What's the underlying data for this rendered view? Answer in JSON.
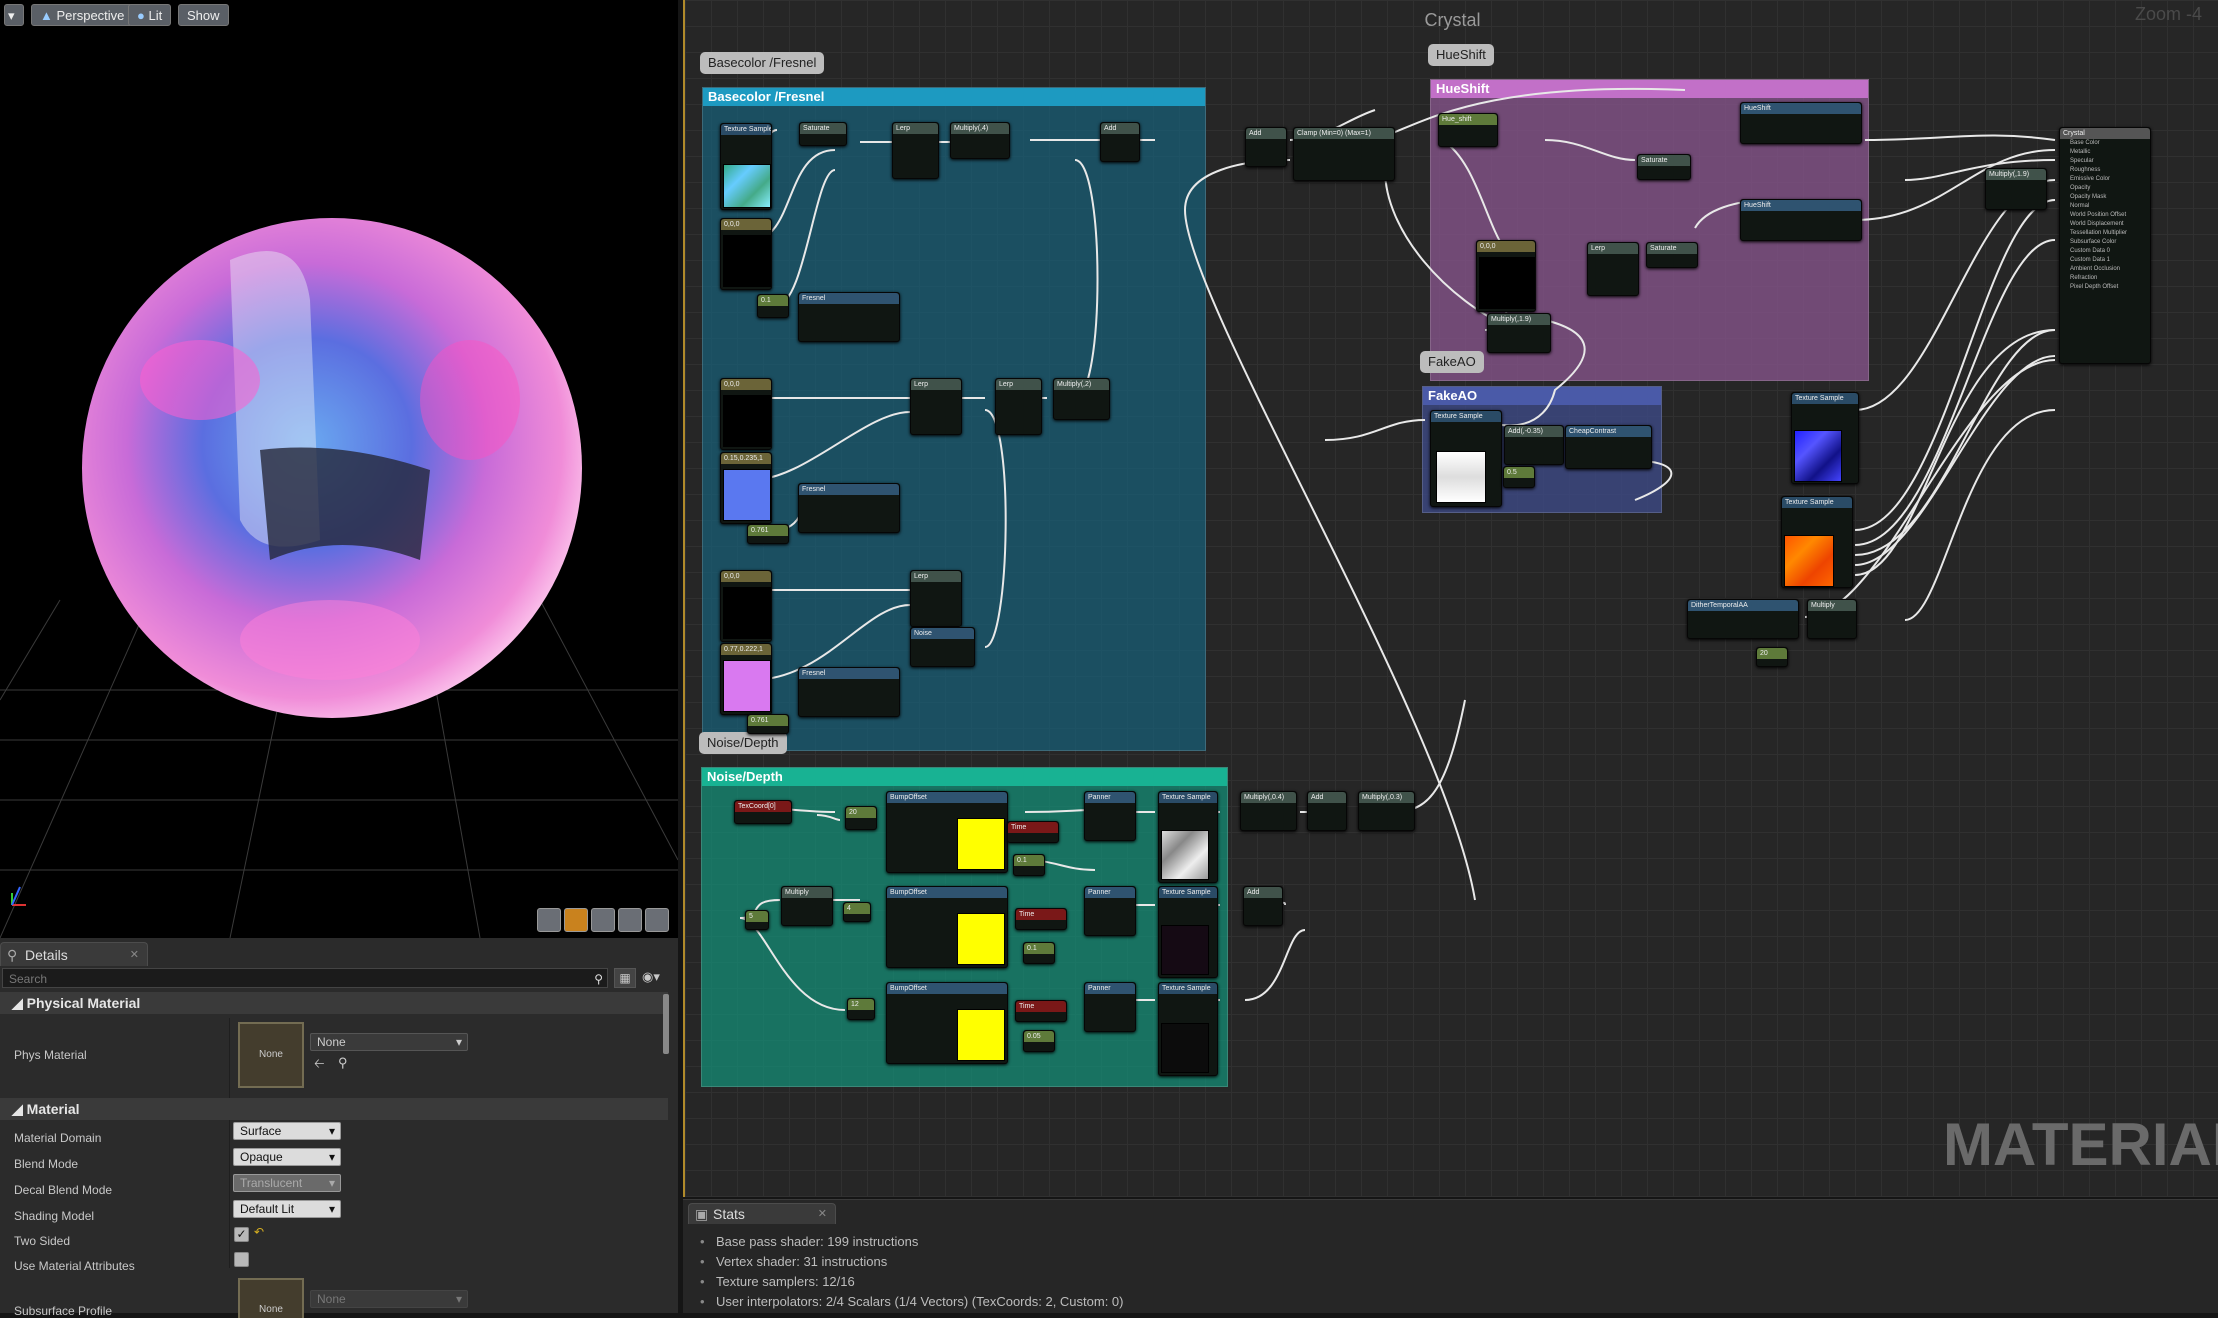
{
  "viewport": {
    "buttons": {
      "perspective": "Perspective",
      "lit": "Lit",
      "show": "Show"
    }
  },
  "details": {
    "tab_label": "Details",
    "search_placeholder": "Search",
    "physical_material": {
      "category": "Physical Material",
      "phys_material_label": "Phys Material",
      "thumb_text": "None",
      "value": "None"
    },
    "material": {
      "category": "Material",
      "properties": [
        {
          "label": "Material Domain",
          "value": "Surface",
          "disabled": false
        },
        {
          "label": "Blend Mode",
          "value": "Opaque",
          "disabled": false
        },
        {
          "label": "Decal Blend Mode",
          "value": "Translucent",
          "disabled": true
        },
        {
          "label": "Shading Model",
          "value": "Default Lit",
          "disabled": false
        }
      ],
      "two_sided_label": "Two Sided",
      "use_material_attributes_label": "Use Material Attributes",
      "subsurface_profile_label": "Subsurface Profile",
      "subsurface_thumb_text": "None",
      "subsurface_value": "None"
    }
  },
  "graph": {
    "title": "Crystal",
    "zoom": "Zoom -4",
    "watermark": "MATERIAL",
    "groups": {
      "basecolor": "Basecolor /Fresnel",
      "hueshift": "HueShift",
      "fakeao": "FakeAO",
      "noise": "Noise/Depth"
    },
    "bubbles": {
      "basecolor": "Basecolor /Fresnel",
      "hueshift": "HueShift",
      "fakeao": "FakeAO",
      "noise": "Noise/Depth"
    },
    "nodes": {
      "tex1": "Texture Sample",
      "saturate1": "Saturate",
      "lerp1": "Lerp",
      "multiply_4": "Multiply(,4)",
      "add1": "Add",
      "const_000": "0,0,0",
      "scalar_01": "0.1",
      "fresnel1": "Fresnel",
      "const_000b": "0,0,0",
      "lerp2": "Lerp",
      "lerp3": "Lerp",
      "multiply_2": "Multiply(,2)",
      "const_blue": "0.15,0.235,1",
      "fresnel2": "Fresnel",
      "scalar_2": "0.761",
      "const_000c": "0,0,0",
      "lerp4": "Lerp",
      "noise": "Noise",
      "const_pink": "0.77,0.222,1",
      "fresnel3": "Fresnel",
      "scalar_3": "0.761",
      "add2": "Add",
      "clamp": "Clamp (Min=0) (Max=1)",
      "hue_shift_param": "Hue_shift",
      "hue_fn1": "HueShift",
      "saturate2": "Saturate",
      "hue_fn2": "HueShift",
      "const_000d": "0,0,0",
      "lerp5": "Lerp",
      "saturate3": "Saturate",
      "multiply_1": "Multiply(,1.9)",
      "tex_ao": "Texture Sample",
      "add_ao": "Add(,-0.35)",
      "cheap_contrast": "CheapContrast",
      "scalar_ao": "0.5",
      "root": "Crystal",
      "multiply_root": "Multiply(,1.9)",
      "tex_blue": "Texture Sample",
      "tex_orange": "Texture Sample",
      "dither": "DitherTemporalAA",
      "multiply_dither": "Multiply",
      "scalar_dither": "20",
      "texcoord": "TexCoord[0]",
      "scalar_20": "20",
      "bump1": "BumpOffset",
      "time1": "Time",
      "scalar_t1": "0.1",
      "panner1": "Panner",
      "tex_n1": "Texture Sample",
      "multiply_n1": "Multiply(,0.4)",
      "add_n1": "Add",
      "multiply_n2": "Multiply(,0.3)",
      "multiply_n": "Multiply",
      "scalar_5": "5",
      "scalar_4": "4",
      "bump2": "BumpOffset",
      "time2": "Time",
      "scalar_t2": "0.1",
      "panner2": "Panner",
      "tex_n2": "Texture Sample",
      "add_n2": "Add",
      "scalar_12": "12",
      "bump3": "BumpOffset",
      "time3": "Time",
      "scalar_t3": "0.05",
      "panner3": "Panner",
      "tex_n3": "Texture Sample"
    },
    "root_pins": [
      "Base Color",
      "Metallic",
      "Specular",
      "Roughness",
      "Emissive Color",
      "Opacity",
      "Opacity Mask",
      "Normal",
      "World Position Offset",
      "World Displacement",
      "Tessellation Multiplier",
      "Subsurface Color",
      "Custom Data 0",
      "Custom Data 1",
      "Ambient Occlusion",
      "Refraction",
      "Pixel Depth Offset"
    ]
  },
  "stats": {
    "tab_label": "Stats",
    "lines": [
      "Base pass shader: 199 instructions",
      "Vertex shader: 31 instructions",
      "Texture samplers: 12/16",
      "User interpolators: 2/4 Scalars (1/4 Vectors) (TexCoords: 2, Custom: 0)"
    ]
  }
}
